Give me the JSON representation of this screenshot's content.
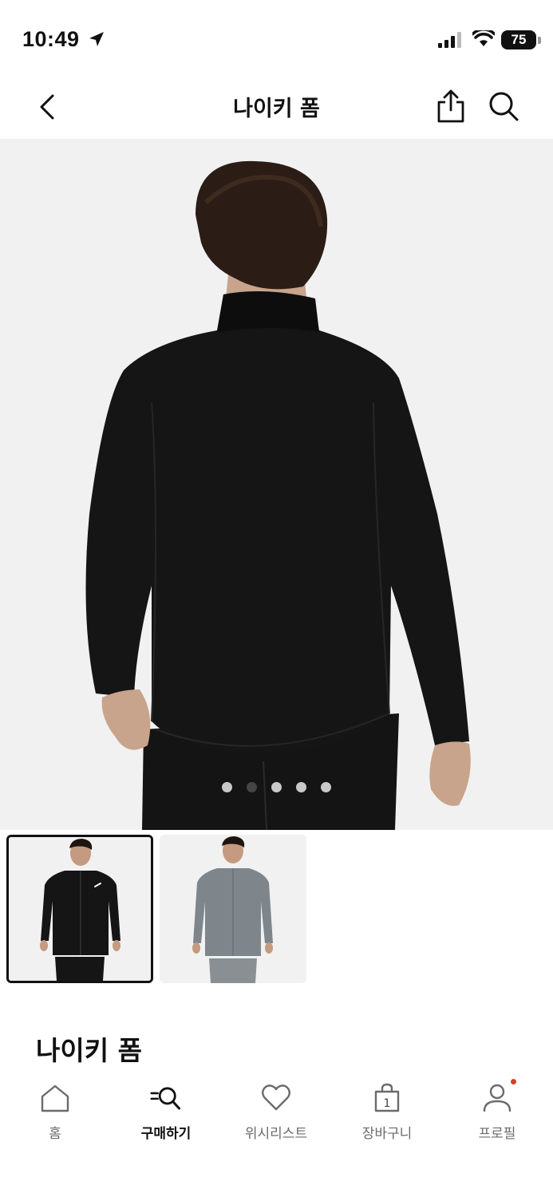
{
  "status": {
    "time": "10:49",
    "battery": "75"
  },
  "nav": {
    "title": "나이키 폼"
  },
  "gallery": {
    "dot_count": 5,
    "active_index": 1,
    "thumbnails": [
      {
        "color": "black",
        "selected": true
      },
      {
        "color": "gray",
        "selected": false
      }
    ]
  },
  "product": {
    "name": "나이키 폼"
  },
  "tabs": [
    {
      "label": "홈",
      "icon": "home-icon",
      "active": false
    },
    {
      "label": "구매하기",
      "icon": "shop-search-icon",
      "active": true
    },
    {
      "label": "위시리스트",
      "icon": "heart-icon",
      "active": false
    },
    {
      "label": "장바구니",
      "icon": "bag-icon",
      "active": false,
      "count": "1"
    },
    {
      "label": "프로필",
      "icon": "profile-icon",
      "active": false
    }
  ],
  "colors": {
    "accent": "#111111",
    "inactive": "#6b6b6b",
    "badge": "#d43f2a",
    "hero_bg": "#f1f1f1"
  }
}
